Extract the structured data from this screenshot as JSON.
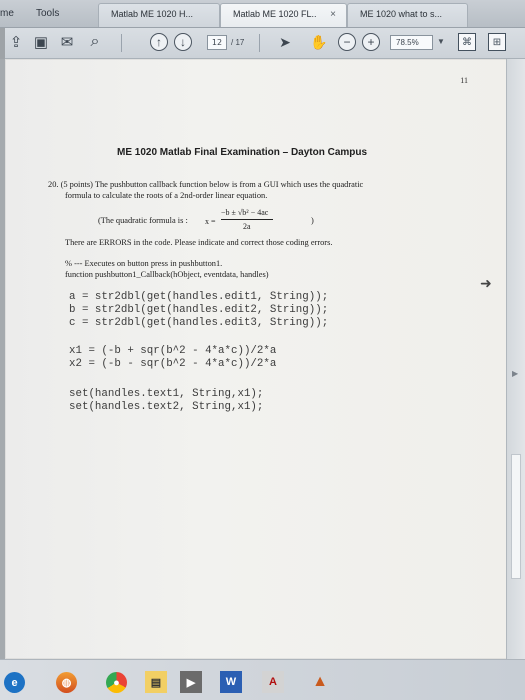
{
  "browser": {
    "partial_tab_left": "me",
    "menu_tools": "Tools",
    "tabs": [
      {
        "label": "Matlab ME 1020 H..."
      },
      {
        "label": "Matlab ME 1020 FL..",
        "close": "×"
      },
      {
        "label": "ME 1020 what to s..."
      }
    ]
  },
  "toolbar": {
    "page_current": "12",
    "page_total": "/ 17",
    "zoom": "78.5%",
    "zoom_arrow": "▼"
  },
  "document": {
    "page_number": "11",
    "title": "ME 1020 Matlab Final Examination – Dayton Campus",
    "question_line_1": "20. (5 points) The pushbutton callback function below is from a GUI which uses the quadratic",
    "question_line_2": "formula to calculate the roots of a 2nd-order linear equation.",
    "formula_intro": "(The quadratic formula is :",
    "formula_end": ")",
    "formula": {
      "x": "x =",
      "numerator": "−b ± √b² − 4ac",
      "denominator": "2a"
    },
    "instruction": "There are ERRORS in the code. Please indicate and correct those coding errors.",
    "comment_line_1": "% --- Executes on button press in pushbutton1.",
    "comment_line_2": "function pushbutton1_Callback(hObject, eventdata, handles)",
    "code": [
      "a = str2dbl(get(handles.edit1, String));",
      "b = str2dbl(get(handles.edit2, String));",
      "c = str2dbl(get(handles.edit3, String));",
      "x1 = (-b + sqr(b^2 - 4*a*c))/2*a",
      "x2 = (-b - sqr(b^2 - 4*a*c))/2*a",
      "set(handles.text1, String,x1);",
      "set(handles.text2, String,x1);"
    ]
  },
  "icons": {
    "share": "share-icon",
    "print": "print-icon",
    "mail": "mail-icon",
    "search": "search-icon",
    "up": "up-icon",
    "down": "down-icon",
    "select": "select-icon",
    "hand": "hand-icon",
    "zoom_out": "zoom-out-icon",
    "zoom_in": "zoom-in-icon",
    "tool_1": "tool-icon",
    "tool_2": "tool-icon"
  },
  "colors": {
    "page": "#F0EFEB",
    "toolbar": "#D4D9DE",
    "taskbar": "#D0D5DB"
  }
}
